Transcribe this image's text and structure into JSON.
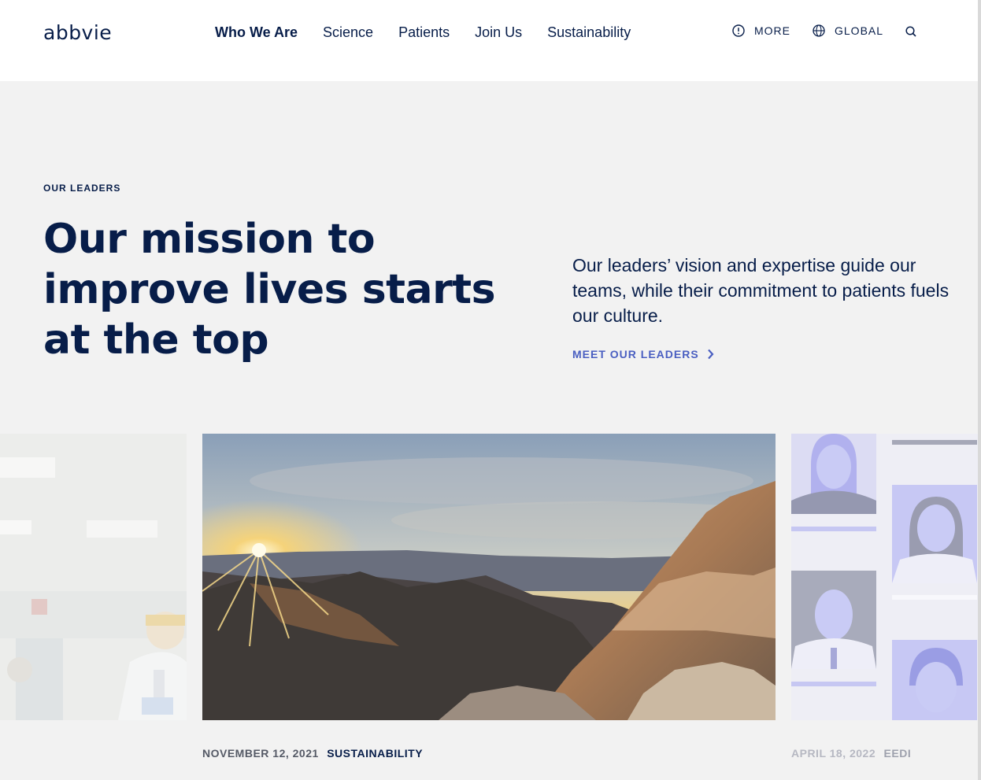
{
  "brand": {
    "logo_text": "abbvie"
  },
  "nav": {
    "items": [
      {
        "label": "Who We Are",
        "active": true
      },
      {
        "label": "Science",
        "active": false
      },
      {
        "label": "Patients",
        "active": false
      },
      {
        "label": "Join Us",
        "active": false
      },
      {
        "label": "Sustainability",
        "active": false
      }
    ]
  },
  "utility": {
    "more_label": "MORE",
    "more_icon": "info-circle-icon",
    "global_label": "GLOBAL",
    "global_icon": "globe-icon",
    "search_icon": "search-icon"
  },
  "hero": {
    "eyebrow": "OUR LEADERS",
    "headline": "Our mission to improve lives starts at the top",
    "intro": "Our leaders’ vision and expertise guide our teams, while their commitment to patients fuels our culture.",
    "cta_label": "MEET OUR LEADERS",
    "cta_icon": "chevron-right-icon"
  },
  "cards": {
    "main": {
      "date": "NOVEMBER 12, 2021",
      "category": "SUSTAINABILITY"
    },
    "right": {
      "date": "APRIL 18, 2022",
      "category": "EEDI"
    }
  },
  "colors": {
    "navy": "#071d49",
    "accent": "#4a5fc1",
    "background": "#f2f2f2",
    "lavender": "#c9cbf5"
  }
}
